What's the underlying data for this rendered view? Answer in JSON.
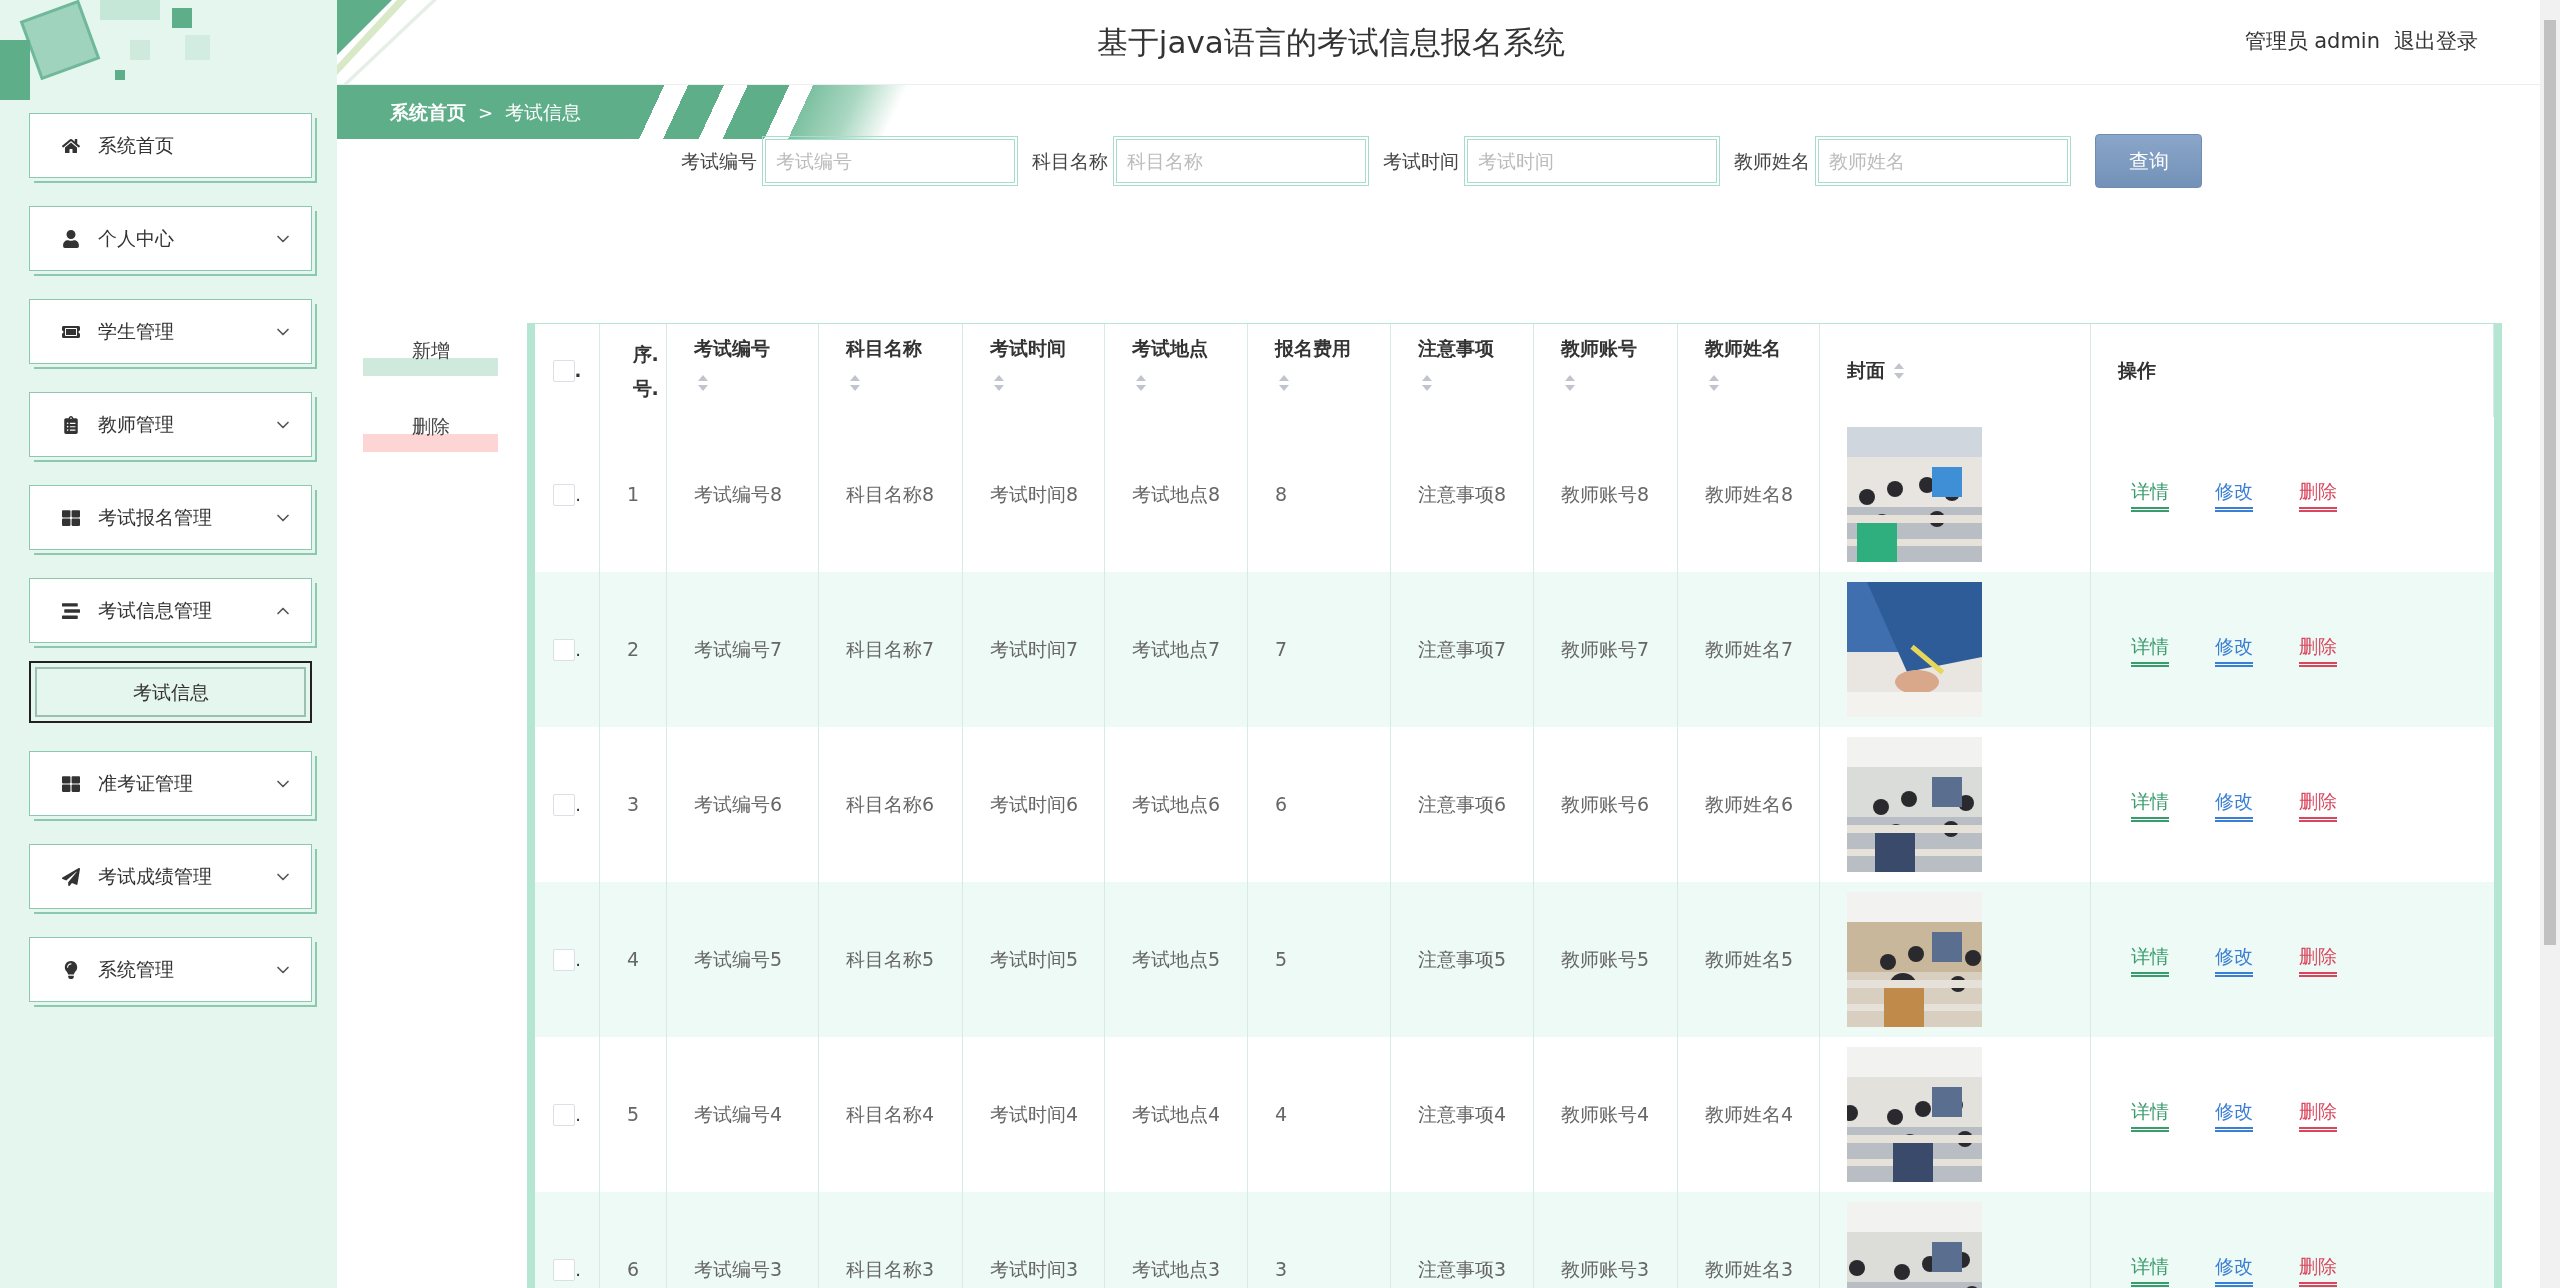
{
  "header": {
    "title": "基于java语言的考试信息报名系统",
    "user": "管理员 admin",
    "logout": "退出登录"
  },
  "sidebar": {
    "items": [
      {
        "label": "系统首页"
      },
      {
        "label": "个人中心",
        "expanded": false
      },
      {
        "label": "学生管理",
        "expanded": false
      },
      {
        "label": "教师管理",
        "expanded": false
      },
      {
        "label": "考试报名管理",
        "expanded": false
      },
      {
        "label": "考试信息管理",
        "expanded": true,
        "children": [
          {
            "label": "考试信息",
            "selected": true
          }
        ]
      },
      {
        "label": "准考证管理",
        "expanded": false
      },
      {
        "label": "考试成绩管理",
        "expanded": false
      },
      {
        "label": "系统管理",
        "expanded": false
      }
    ]
  },
  "breadcrumb": {
    "items": [
      "系统首页",
      "考试信息"
    ],
    "separator": ">"
  },
  "search": {
    "fields": [
      {
        "label": "考试编号",
        "placeholder": "考试编号"
      },
      {
        "label": "科目名称",
        "placeholder": "科目名称"
      },
      {
        "label": "考试时间",
        "placeholder": "考试时间"
      },
      {
        "label": "教师姓名",
        "placeholder": "教师姓名"
      }
    ],
    "button": "查询"
  },
  "actions": [
    {
      "label": "新增",
      "kind": "add"
    },
    {
      "label": "删除",
      "kind": "delete"
    }
  ],
  "table": {
    "header_checked": false,
    "header_check_label": ".",
    "columns": [
      {
        "label": "序.号.",
        "kind": "index",
        "sortable": false
      },
      {
        "label": "考试编号",
        "kind": "text",
        "sortable": true
      },
      {
        "label": "科目名称",
        "kind": "text",
        "sortable": true
      },
      {
        "label": "考试时间",
        "kind": "text",
        "sortable": true
      },
      {
        "label": "考试地点",
        "kind": "text",
        "sortable": true
      },
      {
        "label": "报名费用",
        "kind": "text",
        "sortable": true
      },
      {
        "label": "注意事项",
        "kind": "text",
        "sortable": true
      },
      {
        "label": "教师账号",
        "kind": "text",
        "sortable": true
      },
      {
        "label": "教师姓名",
        "kind": "text",
        "sortable": true
      },
      {
        "label": "封面",
        "sortable": true
      },
      {
        "label": "操作",
        "kind": "actions",
        "sortable": false
      }
    ],
    "rows": [
      {
        "checked": false,
        "check_label": ".",
        "cells": [
          "1",
          "考试编号8",
          "科目名称8",
          "考试时间8",
          "考试地点8",
          "8",
          "注意事项8",
          "教师账号8",
          "教师姓名8"
        ],
        "cover": {
          "kind": "picture"
        },
        "ops": [
          {
            "label": "详情",
            "kind": "detail"
          },
          {
            "label": "修改",
            "kind": "edit"
          },
          {
            "label": "删除",
            "kind": "delete"
          }
        ]
      },
      {
        "checked": false,
        "check_label": ".",
        "cells": [
          "2",
          "考试编号7",
          "科目名称7",
          "考试时间7",
          "考试地点7",
          "7",
          "注意事项7",
          "教师账号7",
          "教师姓名7"
        ],
        "cover": {
          "kind": "picture"
        },
        "ops": [
          {
            "label": "详情",
            "kind": "detail"
          },
          {
            "label": "修改",
            "kind": "edit"
          },
          {
            "label": "删除",
            "kind": "delete"
          }
        ]
      },
      {
        "checked": false,
        "check_label": ".",
        "cells": [
          "3",
          "考试编号6",
          "科目名称6",
          "考试时间6",
          "考试地点6",
          "6",
          "注意事项6",
          "教师账号6",
          "教师姓名6"
        ],
        "cover": {
          "kind": "picture"
        },
        "ops": [
          {
            "label": "详情",
            "kind": "detail"
          },
          {
            "label": "修改",
            "kind": "edit"
          },
          {
            "label": "删除",
            "kind": "delete"
          }
        ]
      },
      {
        "checked": false,
        "check_label": ".",
        "cells": [
          "4",
          "考试编号5",
          "科目名称5",
          "考试时间5",
          "考试地点5",
          "5",
          "注意事项5",
          "教师账号5",
          "教师姓名5"
        ],
        "cover": {
          "kind": "picture"
        },
        "ops": [
          {
            "label": "详情",
            "kind": "detail"
          },
          {
            "label": "修改",
            "kind": "edit"
          },
          {
            "label": "删除",
            "kind": "delete"
          }
        ]
      },
      {
        "checked": false,
        "check_label": ".",
        "cells": [
          "5",
          "考试编号4",
          "科目名称4",
          "考试时间4",
          "考试地点4",
          "4",
          "注意事项4",
          "教师账号4",
          "教师姓名4"
        ],
        "cover": {
          "kind": "picture"
        },
        "ops": [
          {
            "label": "详情",
            "kind": "detail"
          },
          {
            "label": "修改",
            "kind": "edit"
          },
          {
            "label": "删除",
            "kind": "delete"
          }
        ]
      },
      {
        "checked": false,
        "check_label": ".",
        "cells": [
          "6",
          "考试编号3",
          "科目名称3",
          "考试时间3",
          "考试地点3",
          "3",
          "注意事项3",
          "教师账号3",
          "教师姓名3"
        ],
        "cover": {
          "kind": "picture"
        },
        "ops": [
          {
            "label": "详情",
            "kind": "detail"
          },
          {
            "label": "修改",
            "kind": "edit"
          },
          {
            "label": "删除",
            "kind": "delete"
          }
        ]
      }
    ]
  }
}
